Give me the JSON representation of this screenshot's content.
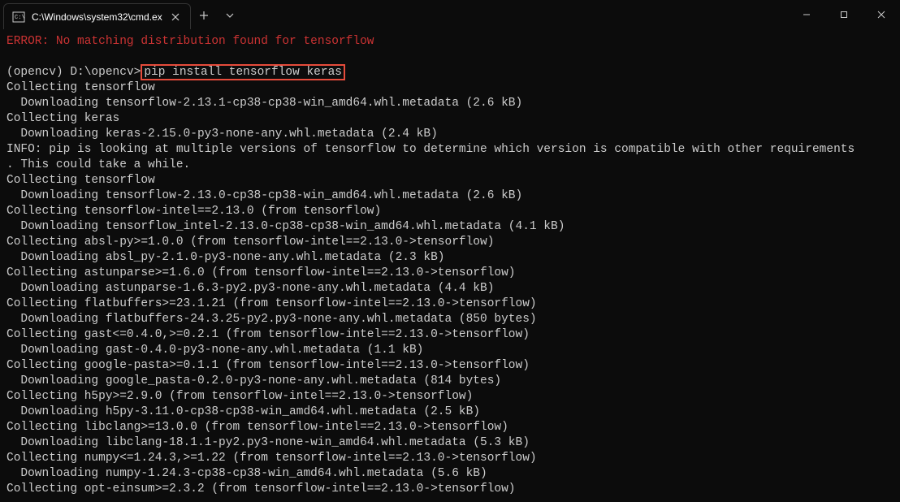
{
  "tab": {
    "title": "C:\\Windows\\system32\\cmd.ex"
  },
  "terminal": {
    "error_line": "ERROR: No matching distribution found for tensorflow",
    "prompt_env": "(opencv) ",
    "prompt_path": "D:\\opencv>",
    "command": "pip install tensorflow keras",
    "lines": [
      "Collecting tensorflow",
      "  Downloading tensorflow-2.13.1-cp38-cp38-win_amd64.whl.metadata (2.6 kB)",
      "Collecting keras",
      "  Downloading keras-2.15.0-py3-none-any.whl.metadata (2.4 kB)",
      "INFO: pip is looking at multiple versions of tensorflow to determine which version is compatible with other requirements",
      ". This could take a while.",
      "Collecting tensorflow",
      "  Downloading tensorflow-2.13.0-cp38-cp38-win_amd64.whl.metadata (2.6 kB)",
      "Collecting tensorflow-intel==2.13.0 (from tensorflow)",
      "  Downloading tensorflow_intel-2.13.0-cp38-cp38-win_amd64.whl.metadata (4.1 kB)",
      "Collecting absl-py>=1.0.0 (from tensorflow-intel==2.13.0->tensorflow)",
      "  Downloading absl_py-2.1.0-py3-none-any.whl.metadata (2.3 kB)",
      "Collecting astunparse>=1.6.0 (from tensorflow-intel==2.13.0->tensorflow)",
      "  Downloading astunparse-1.6.3-py2.py3-none-any.whl.metadata (4.4 kB)",
      "Collecting flatbuffers>=23.1.21 (from tensorflow-intel==2.13.0->tensorflow)",
      "  Downloading flatbuffers-24.3.25-py2.py3-none-any.whl.metadata (850 bytes)",
      "Collecting gast<=0.4.0,>=0.2.1 (from tensorflow-intel==2.13.0->tensorflow)",
      "  Downloading gast-0.4.0-py3-none-any.whl.metadata (1.1 kB)",
      "Collecting google-pasta>=0.1.1 (from tensorflow-intel==2.13.0->tensorflow)",
      "  Downloading google_pasta-0.2.0-py3-none-any.whl.metadata (814 bytes)",
      "Collecting h5py>=2.9.0 (from tensorflow-intel==2.13.0->tensorflow)",
      "  Downloading h5py-3.11.0-cp38-cp38-win_amd64.whl.metadata (2.5 kB)",
      "Collecting libclang>=13.0.0 (from tensorflow-intel==2.13.0->tensorflow)",
      "  Downloading libclang-18.1.1-py2.py3-none-win_amd64.whl.metadata (5.3 kB)",
      "Collecting numpy<=1.24.3,>=1.22 (from tensorflow-intel==2.13.0->tensorflow)",
      "  Downloading numpy-1.24.3-cp38-cp38-win_amd64.whl.metadata (5.6 kB)",
      "Collecting opt-einsum>=2.3.2 (from tensorflow-intel==2.13.0->tensorflow)"
    ]
  }
}
